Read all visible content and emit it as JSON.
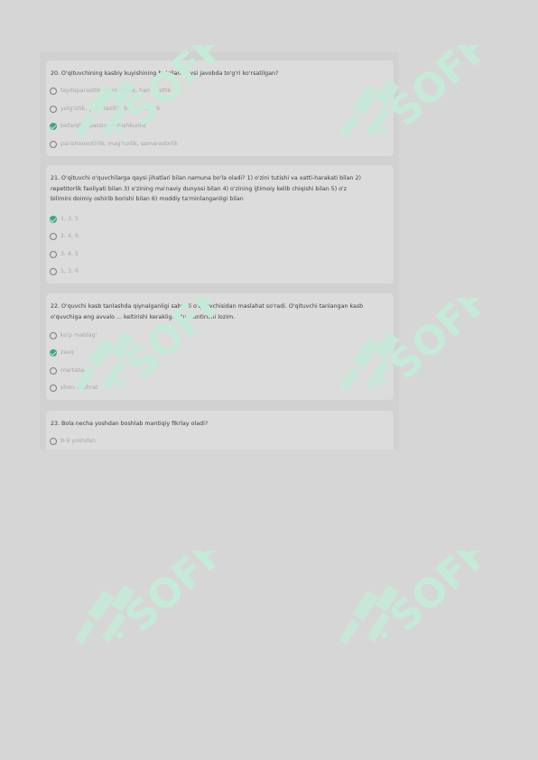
{
  "questions": [
    {
      "text": "20. O'qituvchining kasbiy kuyishining belgilari qaysi javobda to'g'ri ko'rsatilgan?",
      "options": [
        {
          "label": "faydaparastlik, hayrixohlik, hamjihatlik",
          "checked": false
        },
        {
          "label": "yolg'izlik, giperfaollik, bag'rikenglik",
          "checked": false
        },
        {
          "label": "befarqlik, passivlik, tushkunlik",
          "checked": true
        },
        {
          "label": "parishonxotirlik, mag'rurlik, samaradorlik",
          "checked": false
        }
      ]
    },
    {
      "text_lines": [
        "21. O'qituvchi o'quvchilarga qaysi jihatlari bilan namuna bo'la oladi? 1) o'zini tutishi va xatti-harakati bilan 2)",
        "repetitorlik faoliyati bilan 3) o'zining ma'naviy dunyosi bilan 4) o'zining ijtimoiy kelib chiqishi bilan 5) o'z",
        "bilimini doimiy oshirib borishi bilan 6) moddiy ta'minlanganligi bilan"
      ],
      "options": [
        {
          "label": "1, 3, 5",
          "checked": true
        },
        {
          "label": "2, 4, 6",
          "checked": false
        },
        {
          "label": "3, 4, 5",
          "checked": false
        },
        {
          "label": "1, 3, 6",
          "checked": false
        }
      ]
    },
    {
      "text_lines": [
        "22. O'quvchi kasb tanlashda qiynalganligi sababli o'qituvchisidan maslahat so'radi. O'qituvchi tanlangan kasb",
        "o'quvchiga eng avvalo ... keltirishi kerakligini tushuntirishi lozim."
      ],
      "options": [
        {
          "label": "ko'p mablag'",
          "checked": false
        },
        {
          "label": "zavq",
          "checked": true
        },
        {
          "label": "martaba",
          "checked": false
        },
        {
          "label": "shon-shuhrat",
          "checked": false
        }
      ]
    },
    {
      "text": "23. Bola necha yoshdan boshlab mantiqiy fikrlay oladi?",
      "options": [
        {
          "label": "8-9 yoshdan",
          "checked": false
        }
      ]
    }
  ],
  "watermark": {
    "text": "SOFF",
    "color": "#c6ead8"
  }
}
